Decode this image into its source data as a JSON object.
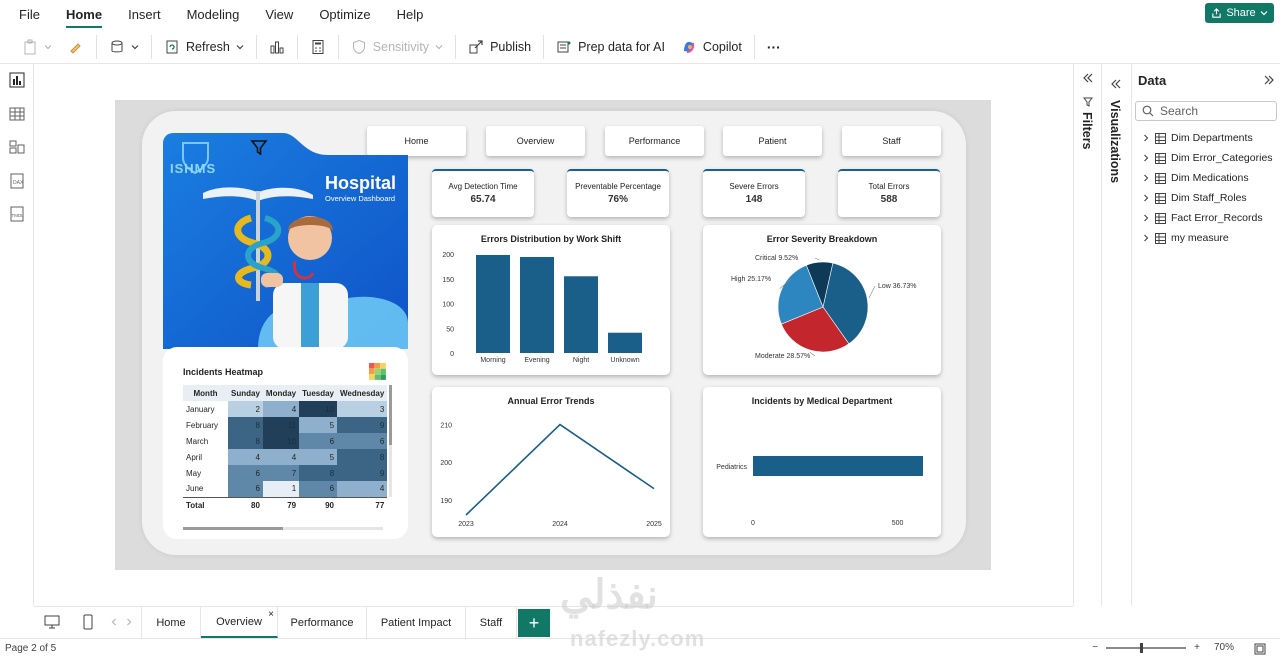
{
  "menu": [
    "File",
    "Home",
    "Insert",
    "Modeling",
    "View",
    "Optimize",
    "Help"
  ],
  "share_label": "Share",
  "toolbar": {
    "refresh": "Refresh",
    "sensitivity": "Sensitivity",
    "publish": "Publish",
    "prep_data": "Prep data for AI",
    "copilot": "Copilot",
    "more": "···"
  },
  "report": {
    "nav": [
      "Home",
      "Overview",
      "Performance",
      "Patient",
      "Staff"
    ],
    "hero": {
      "logo": "ISHMS",
      "title": "Hospital",
      "subtitle": "Overview Dashboard"
    },
    "kpis": [
      {
        "label": "Avg Detection Time",
        "value": "65.74"
      },
      {
        "label": "Preventable Percentage",
        "value": "76%"
      },
      {
        "label": "Severe Errors",
        "value": "148"
      },
      {
        "label": "Total Errors",
        "value": "588"
      }
    ],
    "heatmap": {
      "title": "Incidents Heatmap",
      "columns": [
        "Month",
        "Sunday",
        "Monday",
        "Tuesday",
        "Wednesday"
      ],
      "rows": [
        {
          "month": "January",
          "values": [
            2,
            4,
            10,
            3
          ]
        },
        {
          "month": "February",
          "values": [
            8,
            11,
            5,
            9
          ]
        },
        {
          "month": "March",
          "values": [
            8,
            10,
            6,
            6
          ]
        },
        {
          "month": "April",
          "values": [
            4,
            4,
            5,
            8
          ]
        },
        {
          "month": "May",
          "values": [
            6,
            7,
            8,
            9
          ]
        },
        {
          "month": "June",
          "values": [
            6,
            1,
            6,
            4
          ]
        }
      ],
      "total_label": "Total",
      "totals": [
        "80",
        "79",
        "90",
        "77"
      ]
    }
  },
  "chart_data": [
    {
      "type": "bar",
      "title": "Errors Distribution by Work Shift",
      "categories": [
        "Morning",
        "Evening",
        "Night",
        "Unknown"
      ],
      "values": [
        198,
        194,
        155,
        41
      ],
      "ylim": [
        0,
        200
      ],
      "yticks": [
        "0",
        "50",
        "100",
        "150",
        "200"
      ],
      "color": "#1a5f8a"
    },
    {
      "type": "pie",
      "title": "Error Severity Breakdown",
      "slices": [
        {
          "label": "Low 36.73%",
          "value": 36.73,
          "color": "#1a5f8a"
        },
        {
          "label": "Moderate 28.57%",
          "value": 28.57,
          "color": "#c4262e"
        },
        {
          "label": "High 25.17%",
          "value": 25.17,
          "color": "#2e86c1"
        },
        {
          "label": "Critical 9.52%",
          "value": 9.52,
          "color": "#0d3a56"
        }
      ]
    },
    {
      "type": "line",
      "title": "Annual Error Trends",
      "x": [
        "2023",
        "2024",
        "2025"
      ],
      "values": [
        186,
        210,
        193
      ],
      "ylim": [
        186,
        212
      ],
      "yticks": [
        190,
        200,
        210
      ],
      "color": "#1a5f8a"
    },
    {
      "type": "bar",
      "title": "Incidents by Medical Department",
      "categories": [
        "Pediatrics"
      ],
      "values": [
        588
      ],
      "xlim": [
        0,
        588
      ],
      "xticks": [
        "0",
        "500"
      ],
      "color": "#1a5f8a"
    }
  ],
  "data_pane": {
    "title": "Data",
    "search_placeholder": "Search",
    "items": [
      "Dim Departments",
      "Dim Error_Categories",
      "Dim Medications",
      "Dim Staff_Roles",
      "Fact Error_Records",
      "my measure"
    ]
  },
  "side_labels": {
    "filters": "Filters",
    "visualizations": "Visualizations"
  },
  "page_tabs": [
    "Home",
    "Overview",
    "Performance",
    "Patient Impact",
    "Staff"
  ],
  "tab_close": "×",
  "add_page": "+",
  "status": {
    "page": "Page 2 of 5",
    "zoom": "70%"
  },
  "watermark": {
    "arabic": "نفذلي",
    "latin": "nafezly.com"
  }
}
